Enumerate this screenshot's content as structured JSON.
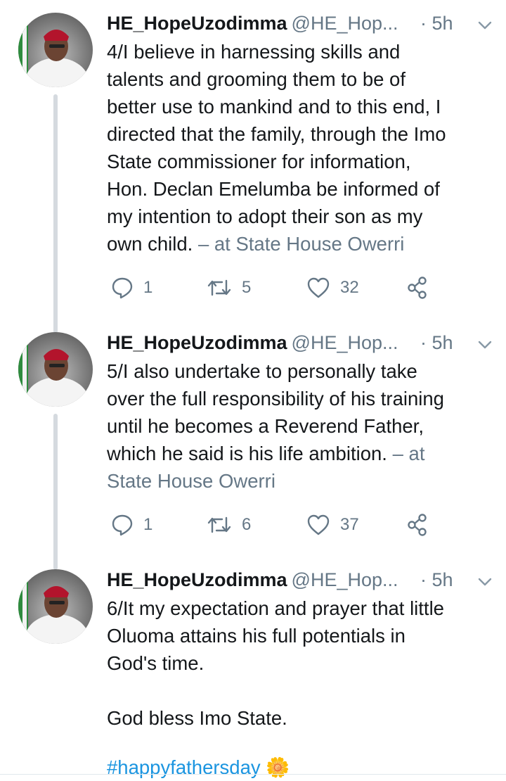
{
  "tweets": [
    {
      "name": "HE_HopeUzodimma",
      "handle": "@HE_Hop...",
      "time": "· 5h",
      "text": "4/I believe in harnessing skills and\ntalents and grooming them to be of\nbetter use to mankind and to this end, I\ndirected that the family, through the Imo\nState commissioner for information,\nHon. Declan Emelumba be informed of\nmy intention to adopt their son as my\nown child. ",
      "location": "– at State House Owerri",
      "replies": "1",
      "retweets": "5",
      "likes": "32"
    },
    {
      "name": "HE_HopeUzodimma",
      "handle": "@HE_Hop...",
      "time": "· 5h",
      "text": "5/I also undertake to personally take\nover the full responsibility of his training\nuntil he becomes a Reverend Father,\nwhich he said is his life ambition. ",
      "location": "– at\nState House Owerri",
      "replies": "1",
      "retweets": "6",
      "likes": "37"
    },
    {
      "name": "HE_HopeUzodimma",
      "handle": "@HE_Hop...",
      "time": "· 5h",
      "text": "6/It my expectation and prayer that little\nOluoma attains his full potentials in\nGod's time.\n\nGod bless Imo State.",
      "hashtag": "#happyfathersday 🌼"
    }
  ],
  "colors": {
    "secondary": "#657786",
    "link": "#1b95e0",
    "thread": "#d5dadf"
  },
  "icons": [
    "reply-icon",
    "retweet-icon",
    "like-icon",
    "share-icon",
    "chevron-down-icon"
  ]
}
